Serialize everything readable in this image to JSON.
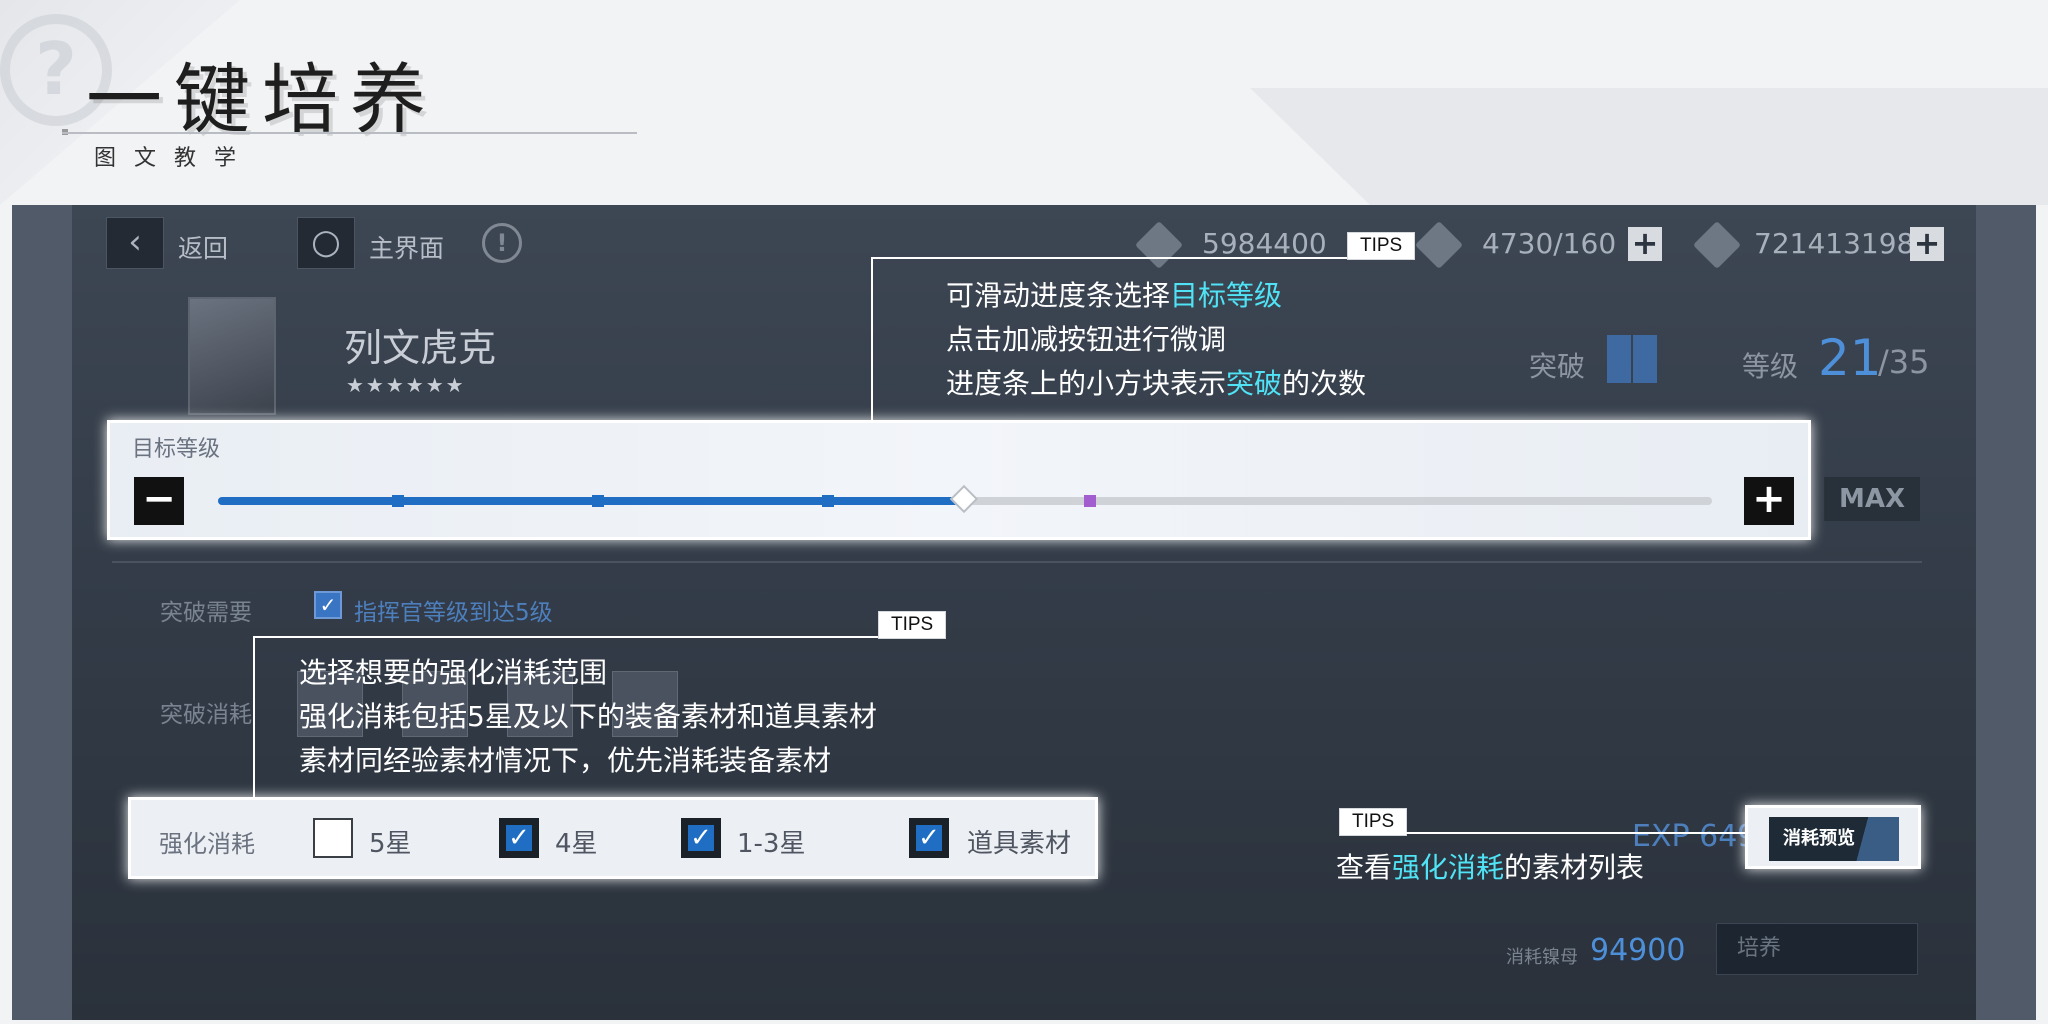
{
  "page": {
    "title": "一键培养",
    "subtitle": "图文教学"
  },
  "topbar": {
    "back_label": "返回",
    "home_label": "主界面",
    "resource_1": "5984400",
    "resource_2": "4730/160",
    "resource_3": "721413198"
  },
  "character": {
    "name": "列文虎克",
    "stars": "★★★★★★",
    "break_label": "突破",
    "level_label": "等级",
    "level_current": "21",
    "level_max": "/35"
  },
  "target_level": {
    "label": "目标等级",
    "minus": "−",
    "plus": "+",
    "max_label": "MAX",
    "progress": 0.5
  },
  "breakthrough": {
    "need_label": "突破需要",
    "need_item": "指挥官等级到达5级",
    "cost_label": "突破消耗"
  },
  "consume": {
    "label": "强化消耗",
    "options": [
      {
        "label": "5星",
        "checked": false
      },
      {
        "label": "4星",
        "checked": true
      },
      {
        "label": "1-3星",
        "checked": true
      },
      {
        "label": "道具素材",
        "checked": true
      }
    ],
    "exp_text": "EXP 6490",
    "preview_label": "消耗预览"
  },
  "bottom": {
    "cost_label": "消耗镍母",
    "cost_value": "94900",
    "cultivate_label": "培养"
  },
  "tips": {
    "tag": "TIPS",
    "slider": {
      "line1_pre": "可滑动进度条选择",
      "line1_hi": "目标等级",
      "line2": "点击加减按钮进行微调",
      "line3_pre": "进度条上的小方块表示",
      "line3_hi": "突破",
      "line3_post": "的次数"
    },
    "consume": {
      "line1": "选择想要的强化消耗范围",
      "line2": "强化消耗包括5星及以下的装备素材和道具素材",
      "line3": "素材同经验素材情况下，优先消耗装备素材"
    },
    "preview": {
      "line1_pre": "查看",
      "line1_hi": "强化消耗",
      "line1_post": "的素材列表"
    }
  },
  "colors": {
    "accent_blue": "#1f6ec4",
    "highlight_cyan": "#4fe3f5",
    "panel_bg": "#333c48"
  }
}
